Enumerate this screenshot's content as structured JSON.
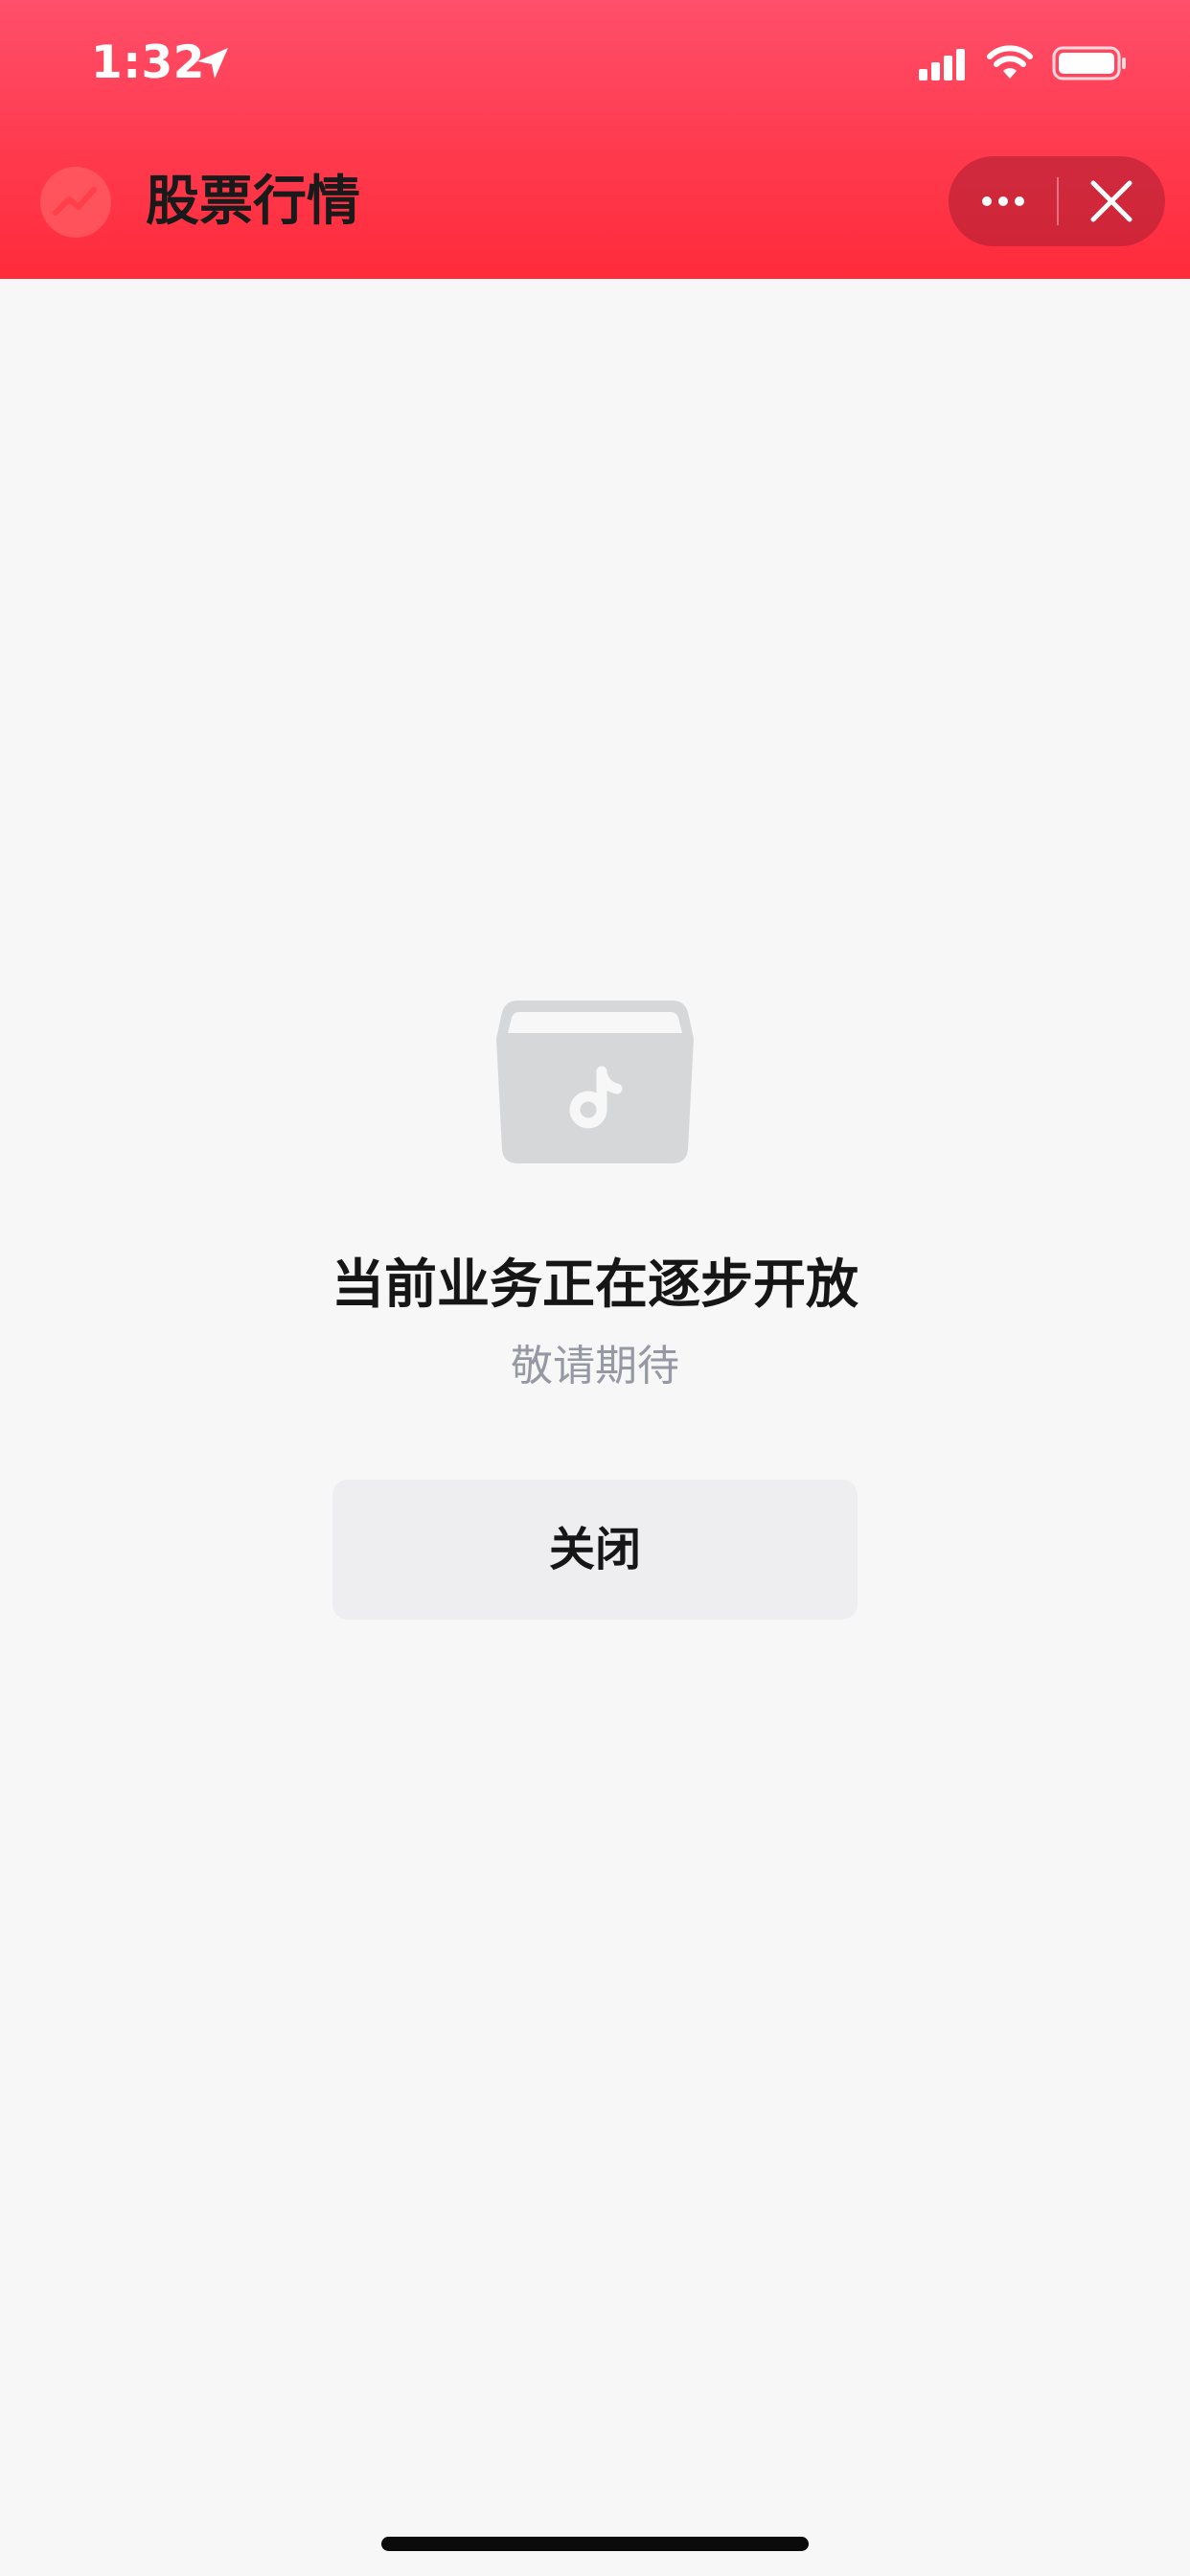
{
  "status_bar": {
    "time": "1:32",
    "icons": [
      "location-arrow-icon",
      "cellular-signal-icon",
      "wifi-icon",
      "battery-icon"
    ]
  },
  "header": {
    "title": "股票行情",
    "logo_icon": "stock-trend-icon",
    "more_icon": "more-dots-icon",
    "close_icon": "close-icon",
    "gradient_colors": [
      "#ff4f6a",
      "#ff2b3b"
    ]
  },
  "main": {
    "empty_icon": "douyin-box-icon",
    "headline": "当前业务正在逐步开放",
    "subline": "敬请期待",
    "close_button_label": "关闭"
  }
}
